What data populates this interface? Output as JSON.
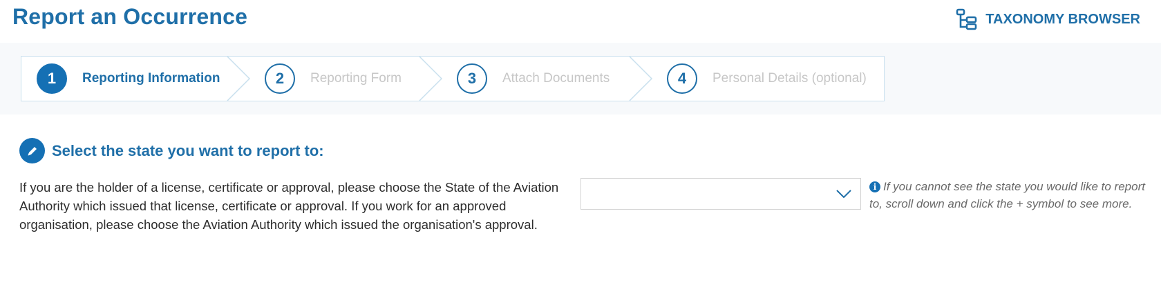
{
  "header": {
    "title": "Report an Occurrence",
    "taxonomy_label": "TAXONOMY BROWSER",
    "taxonomy_icon": "hierarchy-icon"
  },
  "stepper": {
    "steps": [
      {
        "number": "1",
        "label": "Reporting Information",
        "active": true
      },
      {
        "number": "2",
        "label": "Reporting Form",
        "active": false
      },
      {
        "number": "3",
        "label": "Attach Documents",
        "active": false
      },
      {
        "number": "4",
        "label": "Personal Details (optional)",
        "active": false
      }
    ]
  },
  "section": {
    "icon": "pencil-icon",
    "title": "Select the state you want to report to:",
    "instructions": "If you are the holder of a license, certificate or approval, please choose the State of the Aviation Authority which issued that license, certificate or approval. If you work for an approved organisation, please choose the Aviation Authority which issued the organisation's approval.",
    "state_select": {
      "value": ""
    },
    "hint": "If you cannot see the state you would like to report to, scroll down and click the + symbol to see more."
  },
  "colors": {
    "brand": "#1f6fa8",
    "active_step": "#1570b4",
    "inactive_text": "#c7c7c7",
    "border": "#c9e0ee"
  }
}
